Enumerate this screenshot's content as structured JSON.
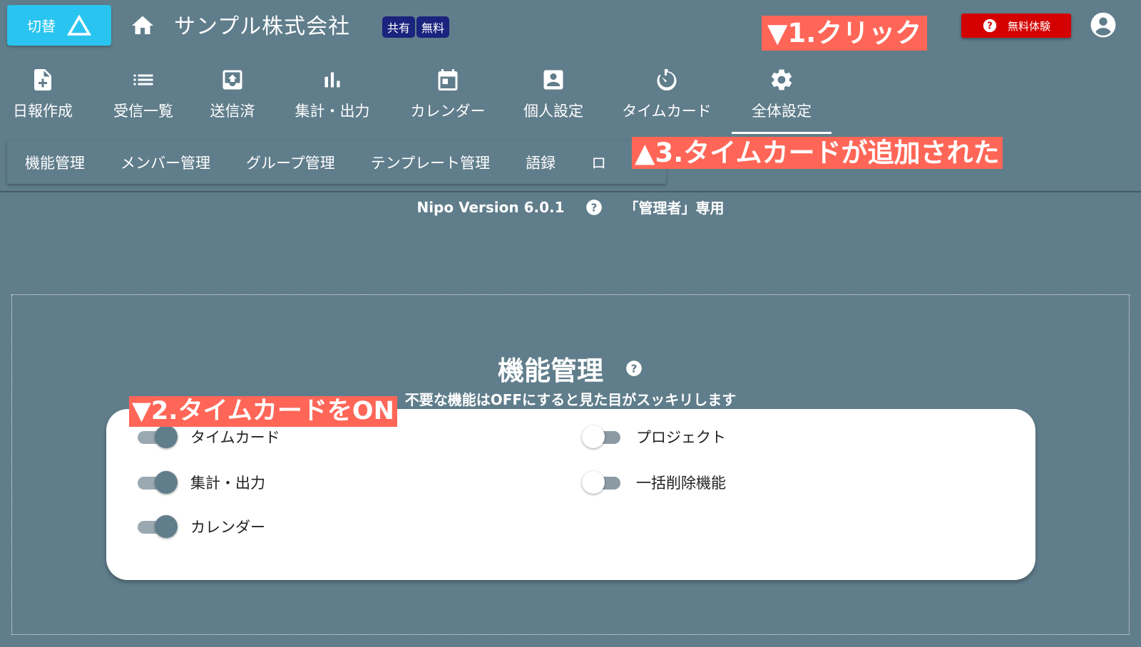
{
  "header": {
    "switch_label": "切替",
    "company_name": "サンプル株式会社",
    "badges": [
      "共有",
      "無料"
    ],
    "trial_label": "無料体験"
  },
  "nav": {
    "items": [
      {
        "label": "日報作成",
        "icon": "note-add-icon"
      },
      {
        "label": "受信一覧",
        "icon": "list-icon"
      },
      {
        "label": "送信済",
        "icon": "outbox-icon"
      },
      {
        "label": "集計・出力",
        "icon": "bar-chart-icon"
      },
      {
        "label": "カレンダー",
        "icon": "calendar-icon"
      },
      {
        "label": "個人設定",
        "icon": "person-box-icon"
      },
      {
        "label": "タイムカード",
        "icon": "timer-icon"
      },
      {
        "label": "全体設定",
        "icon": "gear-icon"
      }
    ],
    "active_index": 7
  },
  "subtabs": [
    "機能管理",
    "メンバー管理",
    "グループ管理",
    "テンプレート管理",
    "語録",
    "ロ"
  ],
  "version": {
    "text": "Nipo Version 6.0.1",
    "role": "「管理者」専用"
  },
  "annotations": {
    "step1": "▼1.クリック",
    "step2": "▼2.タイムカードをON",
    "step3": "▲3.タイムカードが追加された"
  },
  "features": {
    "title": "機能管理",
    "description": "不要な機能はOFFにすると見た目がスッキリします",
    "left": [
      {
        "label": "タイムカード",
        "on": true
      },
      {
        "label": "集計・出力",
        "on": true
      },
      {
        "label": "カレンダー",
        "on": true
      }
    ],
    "right": [
      {
        "label": "プロジェクト",
        "on": false
      },
      {
        "label": "一括削除機能",
        "on": false
      }
    ]
  },
  "colors": {
    "background": "#607d8b",
    "switch_button": "#29c5f0",
    "trial_button": "#d40000",
    "badge": "#1a237e",
    "annotation": "#ff6657"
  }
}
